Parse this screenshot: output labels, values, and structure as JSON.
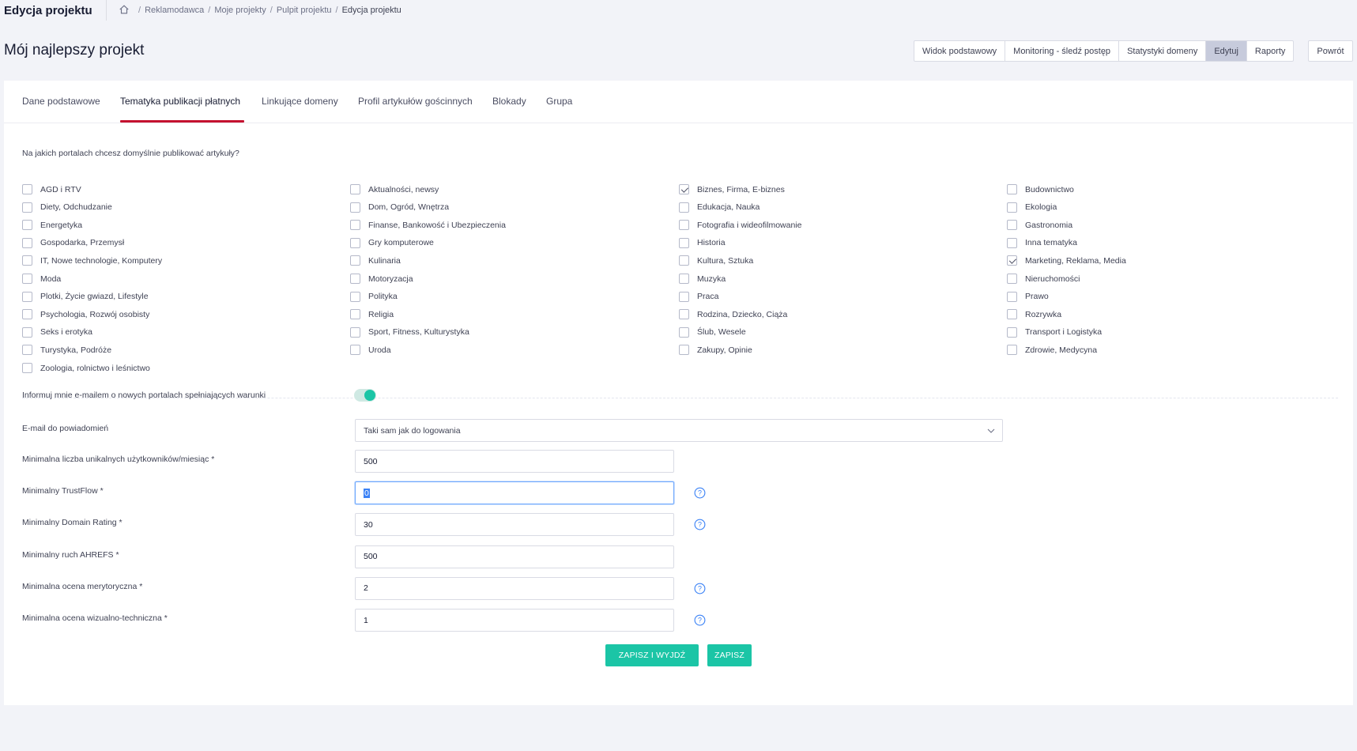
{
  "header": {
    "app_title": "Edycja projektu",
    "breadcrumbs": [
      "Reklamodawca",
      "Moje projekty",
      "Pulpit projektu",
      "Edycja projektu"
    ]
  },
  "page_title": "Mój najlepszy projekt",
  "view_tabs": [
    "Widok podstawowy",
    "Monitoring - śledź postęp",
    "Statystyki domeny",
    "Edytuj",
    "Raporty"
  ],
  "active_view_tab": "Edytuj",
  "back_label": "Powrót",
  "tabs": [
    "Dane podstawowe",
    "Tematyka publikacji płatnych",
    "Linkujące domeny",
    "Profil artykułów gościnnych",
    "Blokady",
    "Grupa"
  ],
  "active_tab": "Tematyka publikacji płatnych",
  "question": "Na jakich portalach chcesz domyślnie publikować artykuły?",
  "categories": [
    {
      "label": "AGD i RTV",
      "checked": false
    },
    {
      "label": "Diety, Odchudzanie",
      "checked": false
    },
    {
      "label": "Energetyka",
      "checked": false
    },
    {
      "label": "Gospodarka, Przemysł",
      "checked": false
    },
    {
      "label": "IT, Nowe technologie, Komputery",
      "checked": false
    },
    {
      "label": "Moda",
      "checked": false
    },
    {
      "label": "Plotki, Życie gwiazd, Lifestyle",
      "checked": false
    },
    {
      "label": "Psychologia, Rozwój osobisty",
      "checked": false
    },
    {
      "label": "Seks i erotyka",
      "checked": false
    },
    {
      "label": "Turystyka, Podróże",
      "checked": false
    },
    {
      "label": "Zoologia, rolnictwo i leśnictwo",
      "checked": false
    },
    {
      "label": "Aktualności, newsy",
      "checked": false
    },
    {
      "label": "Dom, Ogród, Wnętrza",
      "checked": false
    },
    {
      "label": "Finanse, Bankowość i Ubezpieczenia",
      "checked": false
    },
    {
      "label": "Gry komputerowe",
      "checked": false
    },
    {
      "label": "Kulinaria",
      "checked": false
    },
    {
      "label": "Motoryzacja",
      "checked": false
    },
    {
      "label": "Polityka",
      "checked": false
    },
    {
      "label": "Religia",
      "checked": false
    },
    {
      "label": "Sport, Fitness, Kulturystyka",
      "checked": false
    },
    {
      "label": "Uroda",
      "checked": false
    },
    {
      "label": "Biznes, Firma, E-biznes",
      "checked": true
    },
    {
      "label": "Edukacja, Nauka",
      "checked": false
    },
    {
      "label": "Fotografia i wideofilmowanie",
      "checked": false
    },
    {
      "label": "Historia",
      "checked": false
    },
    {
      "label": "Kultura, Sztuka",
      "checked": false
    },
    {
      "label": "Muzyka",
      "checked": false
    },
    {
      "label": "Praca",
      "checked": false
    },
    {
      "label": "Rodzina, Dziecko, Ciąża",
      "checked": false
    },
    {
      "label": "Ślub, Wesele",
      "checked": false
    },
    {
      "label": "Zakupy, Opinie",
      "checked": false
    },
    {
      "label": "Budownictwo",
      "checked": false
    },
    {
      "label": "Ekologia",
      "checked": false
    },
    {
      "label": "Gastronomia",
      "checked": false
    },
    {
      "label": "Inna tematyka",
      "checked": false
    },
    {
      "label": "Marketing, Reklama, Media",
      "checked": true
    },
    {
      "label": "Nieruchomości",
      "checked": false
    },
    {
      "label": "Prawo",
      "checked": false
    },
    {
      "label": "Rozrywka",
      "checked": false
    },
    {
      "label": "Transport i Logistyka",
      "checked": false
    },
    {
      "label": "Zdrowie, Medycyna",
      "checked": false
    }
  ],
  "notify": {
    "label": "Informuj mnie e-mailem o nowych portalach spełniających warunki",
    "enabled": true
  },
  "email": {
    "label": "E-mail do powiadomień",
    "value": "Taki sam jak do logowania"
  },
  "fields": [
    {
      "label": "Minimalna liczba unikalnych użytkowników/miesiąc *",
      "value": "500",
      "help": false
    },
    {
      "label": "Minimalny TrustFlow *",
      "value": "0",
      "help": true,
      "focused": true
    },
    {
      "label": "Minimalny Domain Rating *",
      "value": "30",
      "help": true
    },
    {
      "label": "Minimalny ruch AHREFS *",
      "value": "500",
      "help": false
    },
    {
      "label": "Minimalna ocena merytoryczna *",
      "value": "2",
      "help": true
    },
    {
      "label": "Minimalna ocena wizualno-techniczna *",
      "value": "1",
      "help": true
    }
  ],
  "buttons": {
    "save_exit": "ZAPISZ I WYJDŹ",
    "save": "ZAPISZ"
  },
  "colors": {
    "accent": "#1bc5a6",
    "tab_underline": "#c4122f",
    "active_view_tab": "#c7cbdc"
  },
  "icons": {
    "home": "home-icon",
    "chevron": "chevron-down-icon",
    "help": "question-circle-icon"
  }
}
